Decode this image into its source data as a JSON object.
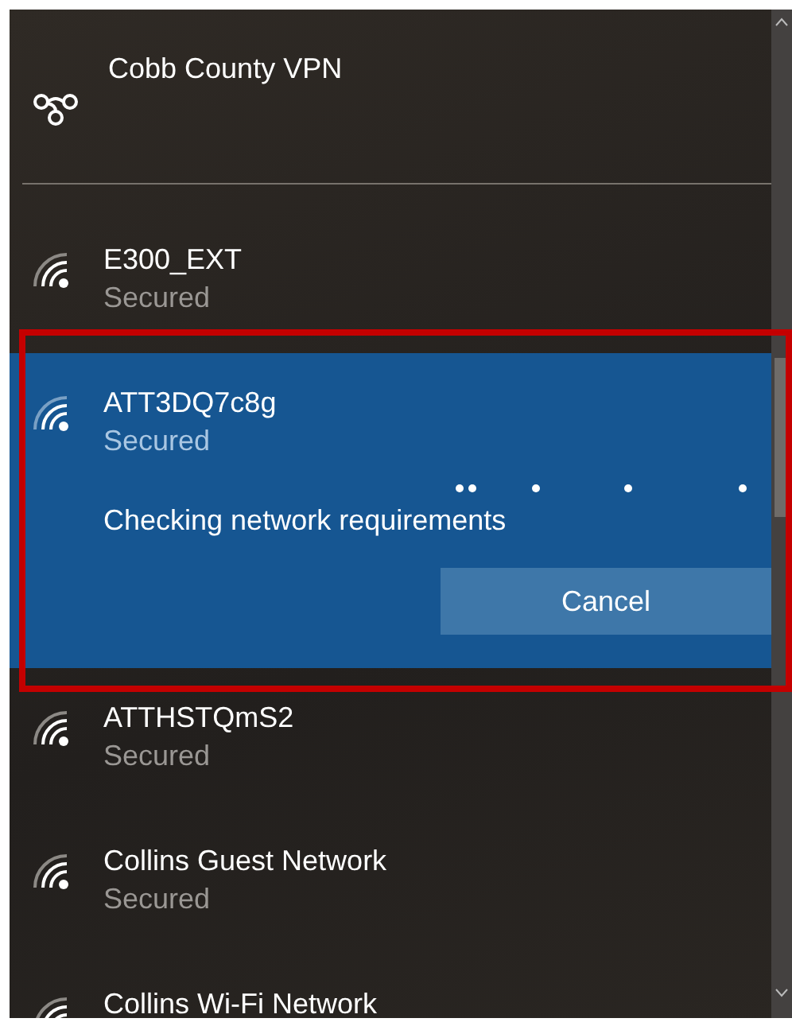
{
  "vpn": {
    "name": "Cobb County VPN"
  },
  "networks": [
    {
      "name": "E300_EXT",
      "status": "Secured",
      "selected": false
    },
    {
      "name": "ATT3DQ7c8g",
      "status": "Secured",
      "selected": true,
      "message": "Checking network requirements",
      "action": "Cancel"
    },
    {
      "name": "ATTHSTQmS2",
      "status": "Secured",
      "selected": false
    },
    {
      "name": "Collins Guest Network",
      "status": "Secured",
      "selected": false
    },
    {
      "name": "Collins Wi-Fi Network",
      "selected": false
    }
  ]
}
